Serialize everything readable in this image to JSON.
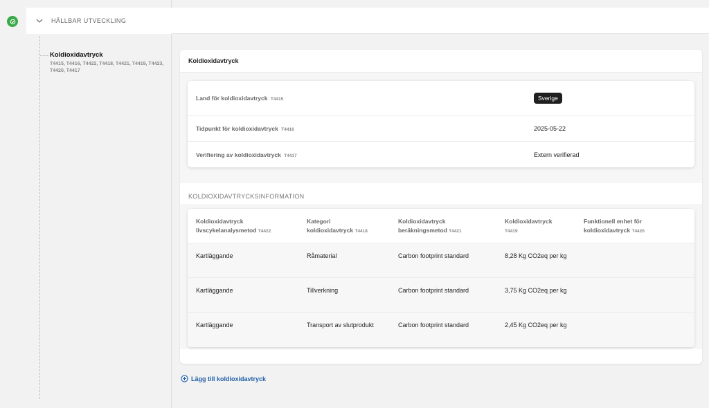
{
  "sidebar": {
    "section_title": "HÄLLBAR UTVECKLING",
    "item_name": "Koldioxidavtryck",
    "item_codes": "T4415, T4416, T4422, T4418, T4421, T4419, T4423, T4420, T4417"
  },
  "card": {
    "title": "Koldioxidavtryck",
    "fields": [
      {
        "label": "Land för koldioxidavtryck",
        "code": "T4415",
        "value": "Sverige",
        "style": "pill"
      },
      {
        "label": "Tidpunkt för koldioxidavtryck",
        "code": "T4416",
        "value": "2025-05-22"
      },
      {
        "label": "Verifiering av koldioxidavtryck",
        "code": "T4417",
        "value": "Extern verifierad"
      }
    ],
    "info_section_label": "KOLDIOXIDAVTRYCKSINFORMATION",
    "table": {
      "headers": [
        {
          "line1": "Koldioxidavtryck",
          "line2": "livscykelanalysmetod",
          "code": "T4422"
        },
        {
          "line1": "Kategori",
          "line2": "koldioxidavtryck",
          "code": "T4418"
        },
        {
          "line1": "Koldioxidavtryck",
          "line2": "beräkningsmetod",
          "code": "T4421"
        },
        {
          "line1": "Koldioxidavtryck",
          "line2": "",
          "code": "T4419"
        },
        {
          "line1": "Funktionell enhet för",
          "line2": "koldioxidavtryck",
          "code": "T4420"
        }
      ],
      "rows": [
        [
          "Kartläggande",
          "Råmaterial",
          "Carbon footprint standard",
          "8,28 Kg CO2eq per kg",
          ""
        ],
        [
          "Kartläggande",
          "Tillverkning",
          "Carbon footprint standard",
          "3,75 Kg CO2eq per kg",
          ""
        ],
        [
          "Kartläggande",
          "Transport av slutprodukt",
          "Carbon footprint standard",
          "2,45 Kg CO2eq per kg",
          ""
        ]
      ]
    }
  },
  "add_link_label": "Lägg till koldioxidavtryck",
  "colors": {
    "status_green": "#3aa94a",
    "link_blue": "#1f5fa8",
    "pill_bg": "#1f1f1f"
  }
}
